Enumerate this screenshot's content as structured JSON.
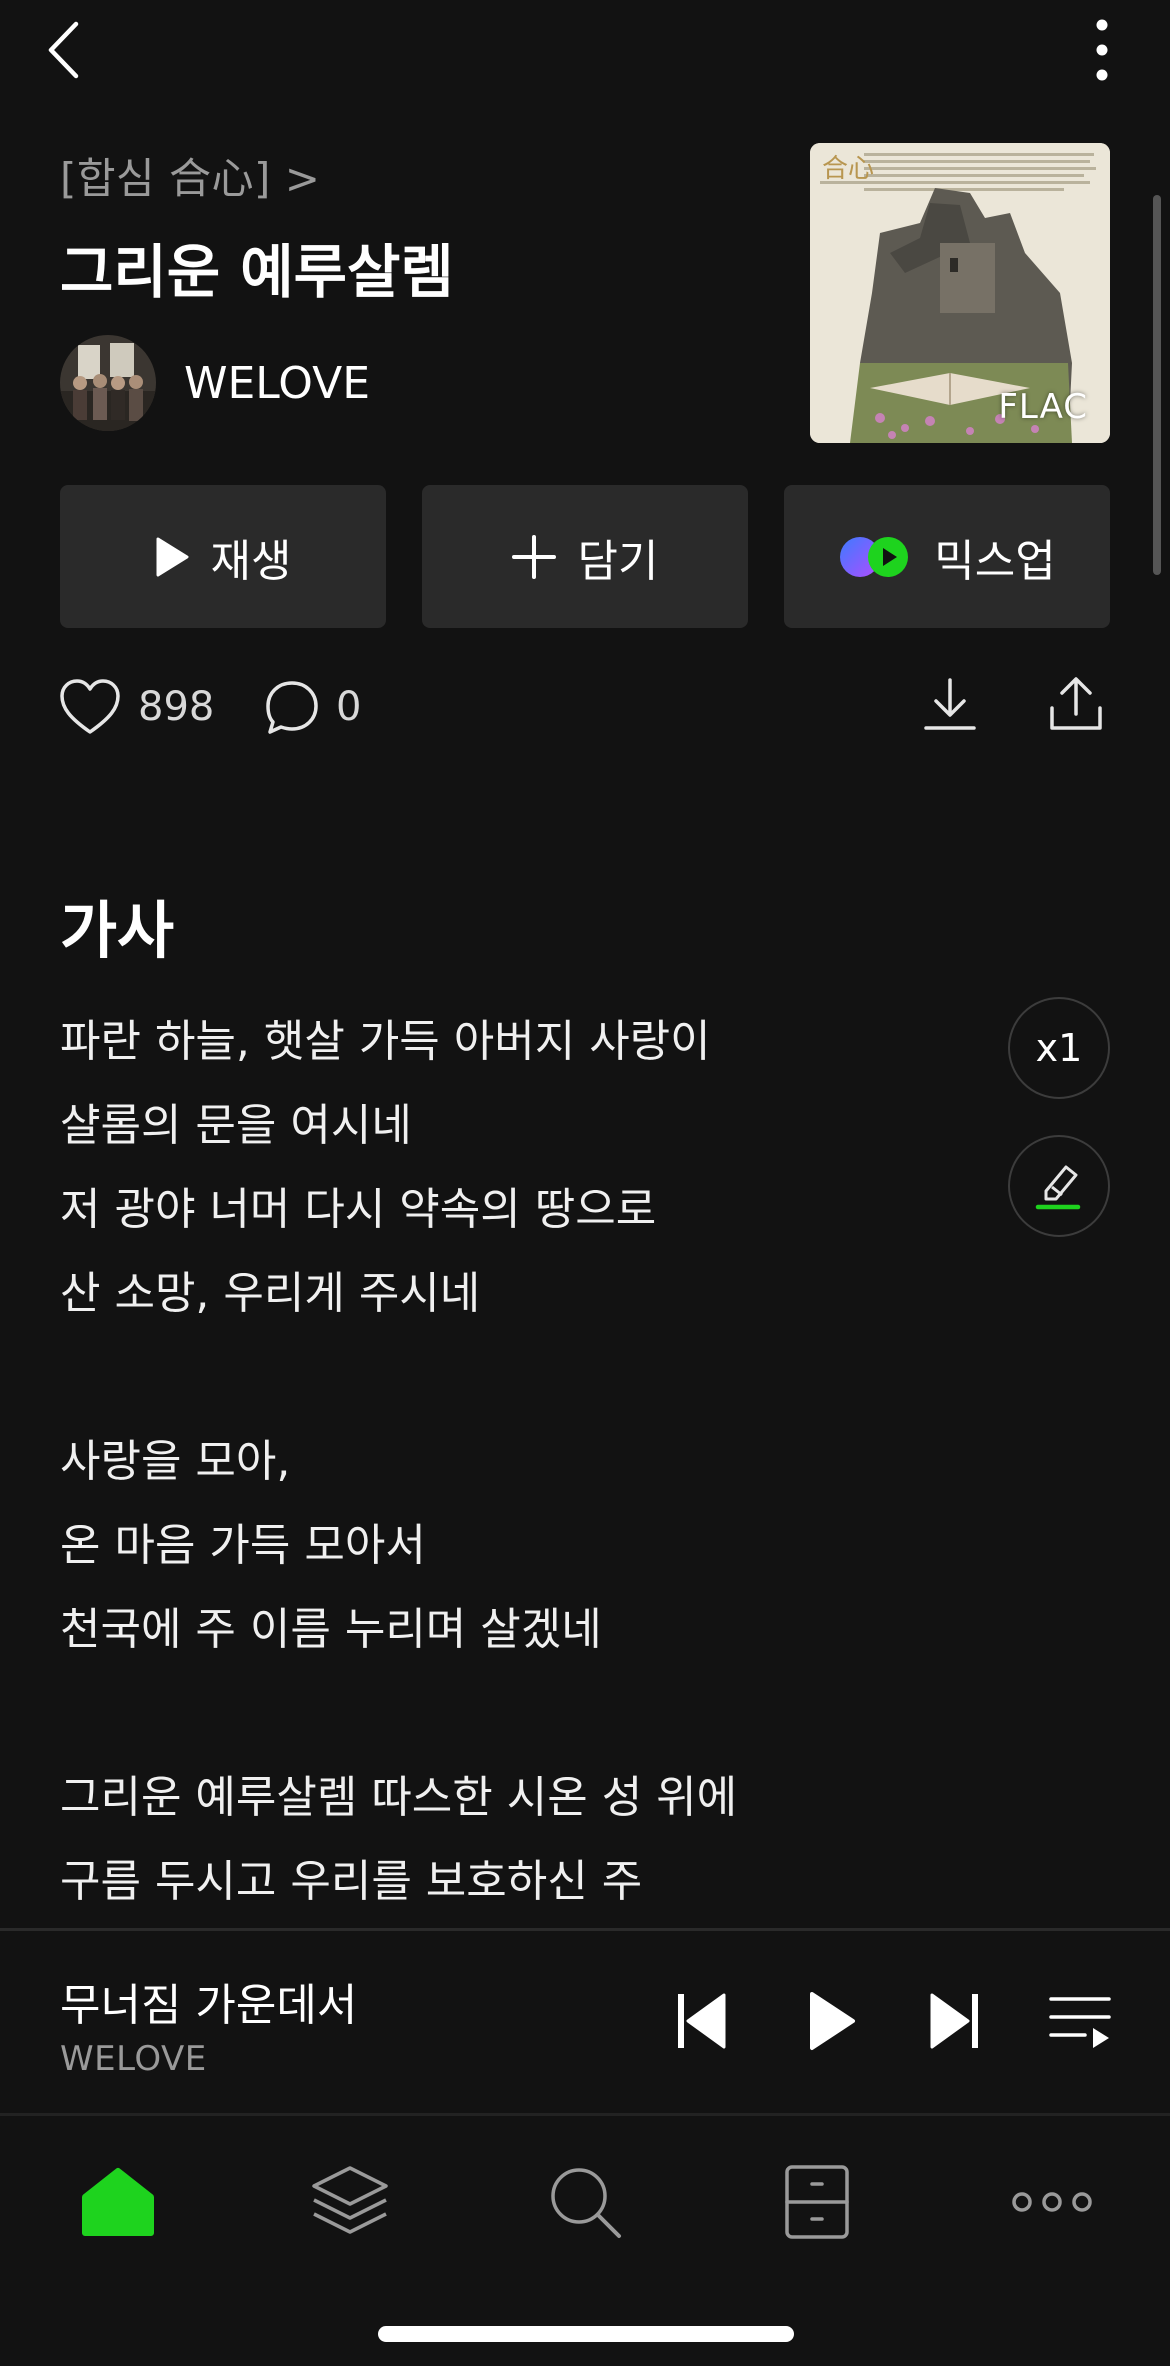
{
  "header": {
    "album_link": "[합심 合心] >",
    "song_title": "그리운 예루살렘",
    "artist": "WELOVE",
    "album_badge": "FLAC",
    "album_art_caption": "合心"
  },
  "actions": {
    "play_label": "재생",
    "add_label": "담기",
    "mixup_label": "믹스업"
  },
  "meta": {
    "like_count": "898",
    "comment_count": "0"
  },
  "lyrics": {
    "heading": "가사",
    "lines": [
      "파란 하늘, 햇살 가득 아버지 사랑이",
      "샬롬의 문을 여시네",
      "저 광야 너머 다시 약속의 땅으로",
      "산 소망, 우리게 주시네",
      "",
      "사랑을 모아,",
      "온 마음 가득 모아서",
      "천국에 주 이름 누리며 살겠네",
      "",
      "그리운 예루살렘 따스한 시온 성 위에",
      "구름 두시고 우리를 보호하신 주"
    ],
    "speed_label": "x1"
  },
  "mini_player": {
    "title": "무너짐 가운데서",
    "artist": "WELOVE"
  },
  "colors": {
    "accent": "#1ed31e",
    "background": "#121212",
    "button_bg": "#2a2a2a"
  },
  "nav": {
    "items": [
      "home-icon",
      "layers-icon",
      "search-icon",
      "locker-icon",
      "more-icon"
    ]
  }
}
